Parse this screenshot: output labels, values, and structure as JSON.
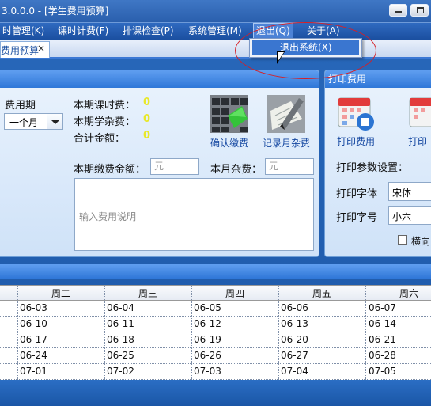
{
  "window": {
    "title": "3.0.0.0 - [学生费用预算]"
  },
  "menu": {
    "items": [
      "时管理(K)",
      "课时计费(F)",
      "排课检查(P)",
      "系统管理(M)",
      "退出(Q)",
      "关于(A)"
    ],
    "open_item": "退出(Q)"
  },
  "dropdown": {
    "items": [
      "退出系统(X)"
    ]
  },
  "tab": {
    "label": "费用预算",
    "close": "×"
  },
  "fee_panel": {
    "period_label": "费用期",
    "period_value": "一个月",
    "lesson_fee_label": "本期课时费：",
    "lesson_fee_value": "0",
    "misc_fee_label": "本期学杂费：",
    "misc_fee_value": "0",
    "total_label": "合计金额：",
    "total_value": "0",
    "confirm_label": "确认缴费",
    "record_label": "记录月杂费",
    "pay_amount_label": "本期缴费金额：",
    "pay_amount_placeholder": "元",
    "month_misc_label": "本月杂费：",
    "month_misc_placeholder": "元",
    "note_placeholder": "输入费用说明"
  },
  "print_panel": {
    "title": "打印费用",
    "print_label": "打印费用",
    "print2_label": "打印",
    "settings_label": "打印参数设置：",
    "font_label": "打印字体",
    "font_value": "宋体",
    "size_label": "打印字号",
    "size_value": "小六",
    "landscape_label": "横向"
  },
  "schedule": {
    "columns": [
      "周二",
      "周三",
      "周四",
      "周五",
      "周六"
    ],
    "rows": [
      [
        "06-03",
        "06-04",
        "06-05",
        "06-06",
        "06-07"
      ],
      [
        "06-10",
        "06-11",
        "06-12",
        "06-13",
        "06-14"
      ],
      [
        "06-17",
        "06-18",
        "06-19",
        "06-20",
        "06-21"
      ],
      [
        "06-24",
        "06-25",
        "06-26",
        "06-27",
        "06-28"
      ],
      [
        "07-01",
        "07-02",
        "07-03",
        "07-04",
        "07-05"
      ]
    ]
  },
  "colors": {
    "accent": "#2f77d8",
    "value_yellow": "#e8e82a",
    "annotation_red": "#d61f26"
  }
}
